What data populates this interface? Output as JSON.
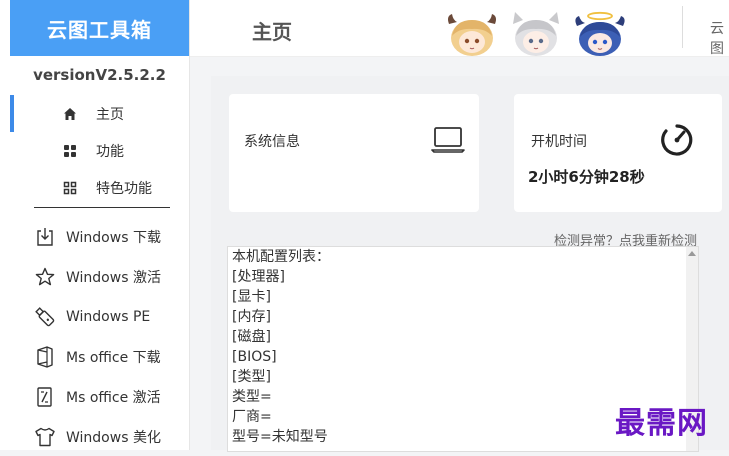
{
  "app": {
    "brand": "云图工具箱",
    "version": "versionV2.5.2.2"
  },
  "nav": [
    {
      "label": "主页",
      "icon": "home-icon",
      "active": true
    },
    {
      "label": "功能",
      "icon": "grid-icon",
      "active": false
    },
    {
      "label": "特色功能",
      "icon": "grid-outline-icon",
      "active": false
    }
  ],
  "tools": [
    {
      "label": "Windows 下载",
      "icon": "download-icon"
    },
    {
      "label": "Windows 激活",
      "icon": "star-icon"
    },
    {
      "label": "Windows PE",
      "icon": "usb-drive-icon"
    },
    {
      "label": "Ms office 下载",
      "icon": "office-icon"
    },
    {
      "label": "Ms office 激活",
      "icon": "office-activate-icon"
    },
    {
      "label": "Windows 美化",
      "icon": "tshirt-icon"
    }
  ],
  "header": {
    "title": "主页",
    "right_text": "云图"
  },
  "system_card": {
    "title": "系统信息",
    "icon": "laptop-icon"
  },
  "uptime_card": {
    "title": "开机时间",
    "value": "2小时6分钟28秒",
    "icon": "speedometer-icon"
  },
  "recheck_link": "检测异常？点我重新检测",
  "config": {
    "lines": [
      "本机配置列表：",
      "[处理器]",
      "[显卡]",
      "[内存]",
      "[磁盘]",
      "[BIOS]",
      "[类型]",
      "类型=",
      "厂商=",
      "型号=未知型号"
    ]
  },
  "watermark": "最需网"
}
